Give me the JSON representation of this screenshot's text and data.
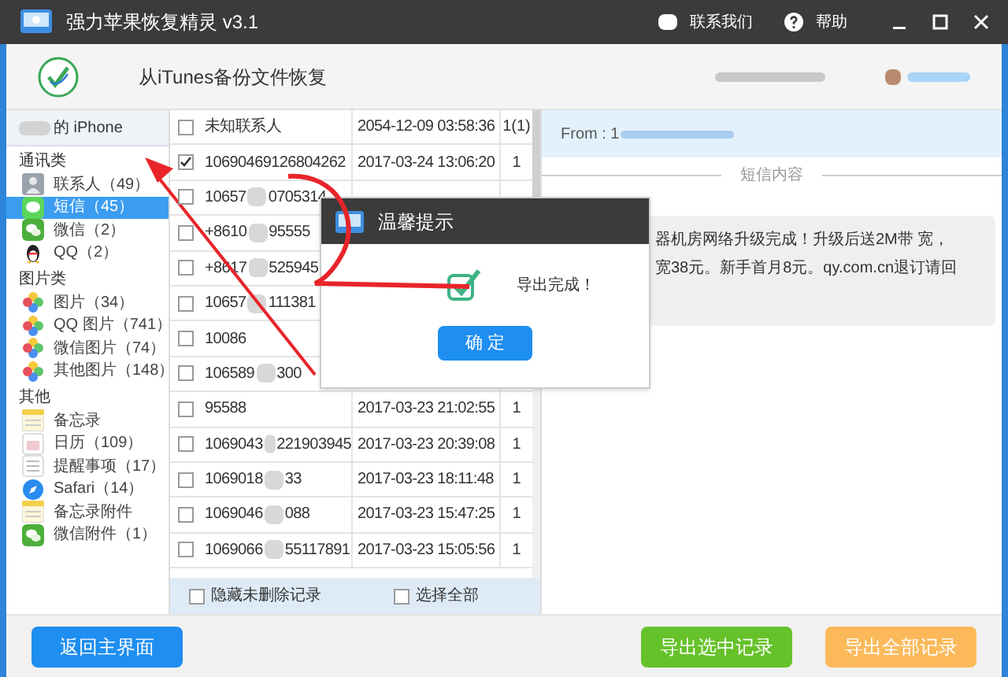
{
  "window": {
    "title": "强力苹果恢复精灵 v3.1",
    "actions": [
      "联系我们",
      "帮助"
    ]
  },
  "header": {
    "title": "从iTunes备份文件恢复"
  },
  "sidebar": {
    "device": "的 iPhone",
    "groups": [
      {
        "label": "通讯类",
        "items": [
          {
            "label": "联系人（49）",
            "kind": "contacts",
            "selected": false
          },
          {
            "label": "短信（45）",
            "kind": "messages",
            "selected": true
          },
          {
            "label": "微信（2）",
            "kind": "wechat",
            "selected": false
          },
          {
            "label": "QQ（2）",
            "kind": "qq",
            "selected": false
          }
        ]
      },
      {
        "label": "图片类",
        "items": [
          {
            "label": "图片（34）",
            "kind": "photos",
            "selected": false
          },
          {
            "label": "QQ 图片（741）",
            "kind": "photos",
            "selected": false
          },
          {
            "label": "微信图片（74）",
            "kind": "photos",
            "selected": false
          },
          {
            "label": "其他图片（148）",
            "kind": "photos",
            "selected": false
          }
        ]
      },
      {
        "label": "其他",
        "items": [
          {
            "label": "备忘录",
            "kind": "notes",
            "selected": false
          },
          {
            "label": "日历（109）",
            "kind": "calendar",
            "selected": false
          },
          {
            "label": "提醒事项（17）",
            "kind": "reminders",
            "selected": false
          },
          {
            "label": "Safari（14）",
            "kind": "safari",
            "selected": false
          },
          {
            "label": "备忘录附件",
            "kind": "notes",
            "selected": false
          },
          {
            "label": "微信附件（1）",
            "kind": "wechat",
            "selected": false
          }
        ]
      }
    ]
  },
  "table": {
    "rows": [
      {
        "checked": false,
        "number": [
          "未知联系人"
        ],
        "date": "2054-12-09 03:58:36",
        "count": "1(1)"
      },
      {
        "checked": true,
        "number": [
          "10690469126804262"
        ],
        "date": "2017-03-24 13:06:20",
        "count": "1"
      },
      {
        "checked": false,
        "number": [
          "10657",
          "0705314"
        ]
      },
      {
        "checked": false,
        "number": [
          "+8610",
          "95555"
        ]
      },
      {
        "checked": false,
        "number": [
          "+8617",
          "525945"
        ]
      },
      {
        "checked": false,
        "number": [
          "10657",
          "111381"
        ]
      },
      {
        "checked": false,
        "number": [
          "10086"
        ]
      },
      {
        "checked": false,
        "number": [
          "106589",
          "300"
        ]
      },
      {
        "checked": false,
        "number": [
          "95588"
        ],
        "date": "2017-03-23 21:02:55",
        "count": "1"
      },
      {
        "checked": false,
        "number": [
          "1069043",
          "221903945"
        ],
        "date": "2017-03-23 20:39:08",
        "count": "1"
      },
      {
        "checked": false,
        "number": [
          "1069018",
          "33"
        ],
        "date": "2017-03-23 18:11:48",
        "count": "1"
      },
      {
        "checked": false,
        "number": [
          "1069046",
          "088"
        ],
        "date": "2017-03-23 15:47:25",
        "count": "1"
      },
      {
        "checked": false,
        "number": [
          "1069066",
          "55117891"
        ],
        "date": "2017-03-23 15:05:56",
        "count": "1"
      }
    ],
    "options": [
      {
        "label": "隐藏未删除记录",
        "checked": false
      },
      {
        "label": "选择全部",
        "checked": false
      }
    ]
  },
  "message": {
    "from": "From : 1",
    "section": "短信内容",
    "lines": [
      "器机房网络升级完成！升级后送2M带 宽，",
      "宽38元。新手首月8元。qy.com.cn退订请回"
    ]
  },
  "dialog": {
    "title": "温馨提示",
    "text": "导出完成！",
    "button": "确 定"
  },
  "footer": {
    "buttons": [
      {
        "label": "返回主界面",
        "color": "#1e8ef0"
      },
      {
        "label": "导出选中记录",
        "color": "#66c22a"
      },
      {
        "label": "导出全部记录",
        "color": "#fbb95a"
      }
    ]
  }
}
